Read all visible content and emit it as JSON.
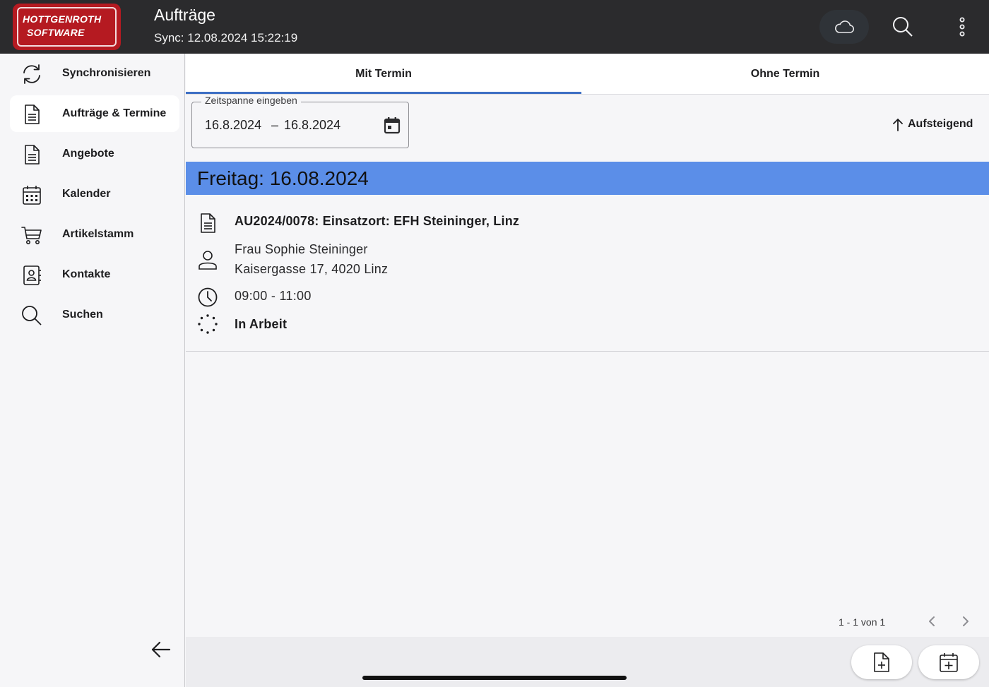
{
  "header": {
    "logo_line1": "Hottgenroth",
    "logo_line2": "Software",
    "title": "Aufträge",
    "sync_text": "Sync: 12.08.2024 15:22:19",
    "icons": [
      "cloud-icon",
      "search-icon",
      "more-vertical-icon"
    ]
  },
  "sidebar": {
    "items": [
      {
        "label": "Synchronisieren",
        "icon": "sync-icon"
      },
      {
        "label": "Aufträge & Termine",
        "icon": "document-icon",
        "active": true
      },
      {
        "label": "Angebote",
        "icon": "document-icon"
      },
      {
        "label": "Kalender",
        "icon": "calendar-icon"
      },
      {
        "label": "Artikelstamm",
        "icon": "cart-icon"
      },
      {
        "label": "Kontakte",
        "icon": "contact-book-icon"
      },
      {
        "label": "Suchen",
        "icon": "search-icon"
      }
    ],
    "back_icon": "arrow-left-icon"
  },
  "tabs": [
    {
      "label": "Mit Termin",
      "selected": true
    },
    {
      "label": "Ohne Termin",
      "selected": false
    }
  ],
  "date_range": {
    "legend": "Zeitspanne eingeben",
    "start": "16.8.2024",
    "separator": "–",
    "end": "16.8.2024"
  },
  "sort": {
    "label": "Aufsteigend",
    "icon": "arrow-up-icon"
  },
  "day_group": {
    "title": "Freitag: 16.08.2024",
    "color": "#5b8ee8",
    "orders": [
      {
        "title": "AU2024/0078: Einsatzort: EFH Steininger, Linz",
        "contact_name": "Frau Sophie Steininger",
        "contact_address": "Kaisergasse 17, 4020 Linz",
        "time": "09:00 - 11:00",
        "status": "In Arbeit"
      }
    ]
  },
  "paginator": {
    "range": "1 - 1 von 1"
  },
  "fabs": [
    "new-document-icon",
    "new-appointment-icon"
  ],
  "colors": {
    "topbar": "#2b2b2d",
    "logo": "#b51a21",
    "accent": "#3d6fc4"
  }
}
